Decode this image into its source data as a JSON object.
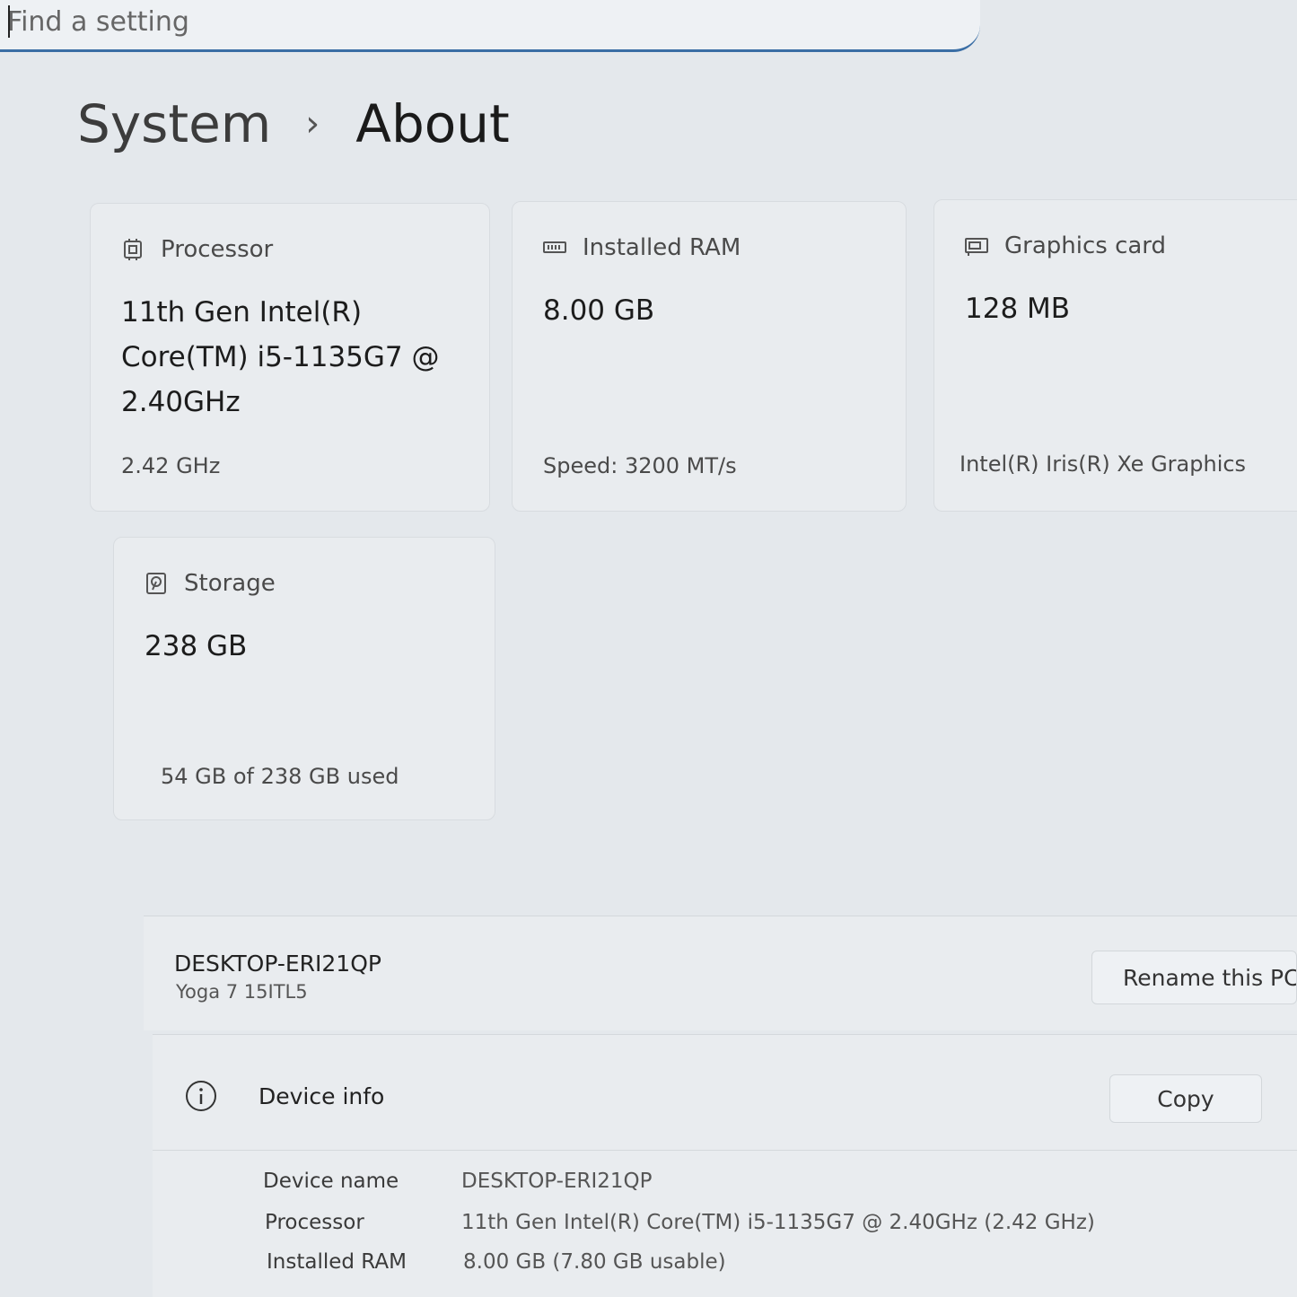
{
  "search": {
    "placeholder": "Find a setting"
  },
  "breadcrumb": {
    "parent": "System",
    "current": "About"
  },
  "cards": {
    "processor": {
      "label": "Processor",
      "value": "11th Gen Intel(R) Core(TM) i5-1135G7 @ 2.40GHz",
      "sub": "2.42 GHz",
      "icon": "processor-icon"
    },
    "ram": {
      "label": "Installed RAM",
      "value": "8.00 GB",
      "sub": "Speed: 3200 MT/s",
      "icon": "ram-icon"
    },
    "graphics": {
      "label": "Graphics card",
      "value": "128 MB",
      "sub": "Intel(R) Iris(R) Xe Graphics",
      "icon": "graphics-card-icon"
    },
    "storage": {
      "label": "Storage",
      "value": "238 GB",
      "sub": "54 GB of 238 GB used",
      "icon": "storage-icon"
    }
  },
  "pc": {
    "name": "DESKTOP-ERI21QP",
    "model": "Yoga 7 15ITL5",
    "rename_label": "Rename this PC"
  },
  "device_info": {
    "title": "Device info",
    "copy_label": "Copy",
    "icon": "info-icon",
    "specs": [
      {
        "label": "Device name",
        "value": "DESKTOP-ERI21QP"
      },
      {
        "label": "Processor",
        "value": "11th Gen Intel(R) Core(TM) i5-1135G7 @ 2.40GHz (2.42 GHz)"
      },
      {
        "label": "Installed RAM",
        "value": "8.00 GB (7.80 GB usable)"
      }
    ]
  }
}
